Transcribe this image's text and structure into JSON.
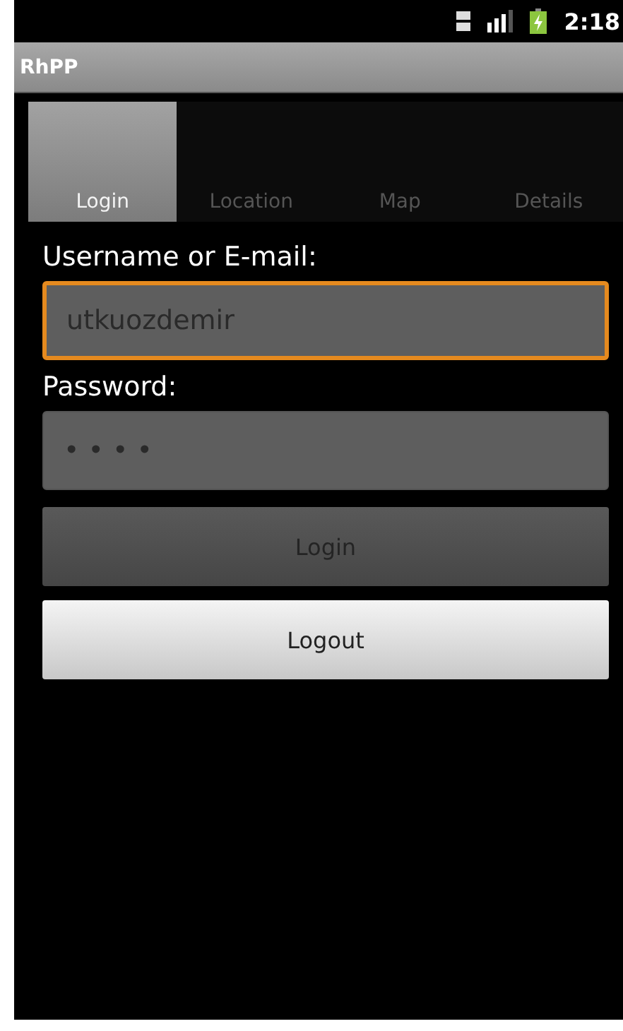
{
  "status_bar": {
    "time": "2:18"
  },
  "title_bar": {
    "title": "RhPP"
  },
  "tabs": [
    {
      "label": "Login",
      "selected": true
    },
    {
      "label": "Location",
      "selected": false
    },
    {
      "label": "Map",
      "selected": false
    },
    {
      "label": "Details",
      "selected": false
    }
  ],
  "fields": [
    {
      "label": "Username or E-mail:",
      "value": "utkuozdemir",
      "focused": true,
      "disabled": true
    },
    {
      "label": "Password:",
      "value": "• • • •",
      "focused": false,
      "disabled": true
    }
  ],
  "buttons": [
    {
      "label": "Login",
      "disabled": true
    },
    {
      "label": "Logout",
      "disabled": false
    }
  ]
}
